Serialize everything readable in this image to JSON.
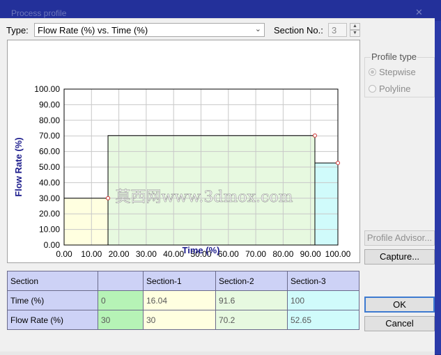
{
  "background_window": {
    "title": "Process profile",
    "close_glyph": "✕"
  },
  "type_row": {
    "label": "Type:",
    "selected": "Flow Rate (%) vs. Time (%)"
  },
  "section_no": {
    "label": "Section No.:",
    "value": "3"
  },
  "profile_type": {
    "title": "Profile type",
    "options": [
      {
        "label": "Stepwise",
        "selected": true
      },
      {
        "label": "Polyline",
        "selected": false
      }
    ]
  },
  "buttons": {
    "advisor": "Profile Advisor...",
    "capture": "Capture...",
    "ok": "OK",
    "cancel": "Cancel"
  },
  "watermark": "莫西网www.3dmox.com",
  "chart_data": {
    "type": "area",
    "xlabel": "Time (%)",
    "ylabel": "Flow Rate (%)",
    "xlim": [
      0,
      100
    ],
    "ylim": [
      0,
      100
    ],
    "x_ticks": [
      "0.00",
      "10.00",
      "20.00",
      "30.00",
      "40.00",
      "50.00",
      "60.00",
      "70.00",
      "80.00",
      "90.00",
      "100.00"
    ],
    "y_ticks": [
      "0.00",
      "10.00",
      "20.00",
      "30.00",
      "40.00",
      "50.00",
      "60.00",
      "70.00",
      "80.00",
      "90.00",
      "100.00"
    ],
    "grid": true,
    "steps": [
      {
        "x0": 0,
        "x1": 16.04,
        "y": 30,
        "color": "#ffffe0"
      },
      {
        "x0": 16.04,
        "x1": 91.6,
        "y": 70.2,
        "color": "#e7f9e0"
      },
      {
        "x0": 91.6,
        "x1": 100,
        "y": 52.65,
        "color": "#d0fbfb"
      }
    ],
    "markers": [
      {
        "x": 16.04,
        "y": 30
      },
      {
        "x": 91.6,
        "y": 70.2
      },
      {
        "x": 100,
        "y": 52.65
      }
    ]
  },
  "table": {
    "headers": [
      "Section",
      "",
      "Section-1",
      "Section-2",
      "Section-3"
    ],
    "rows": [
      {
        "label": "Time (%)",
        "values": [
          "0",
          "16.04",
          "91.6",
          "100"
        ]
      },
      {
        "label": "Flow Rate (%)",
        "values": [
          "30",
          "30",
          "70.2",
          "52.65"
        ]
      }
    ]
  }
}
